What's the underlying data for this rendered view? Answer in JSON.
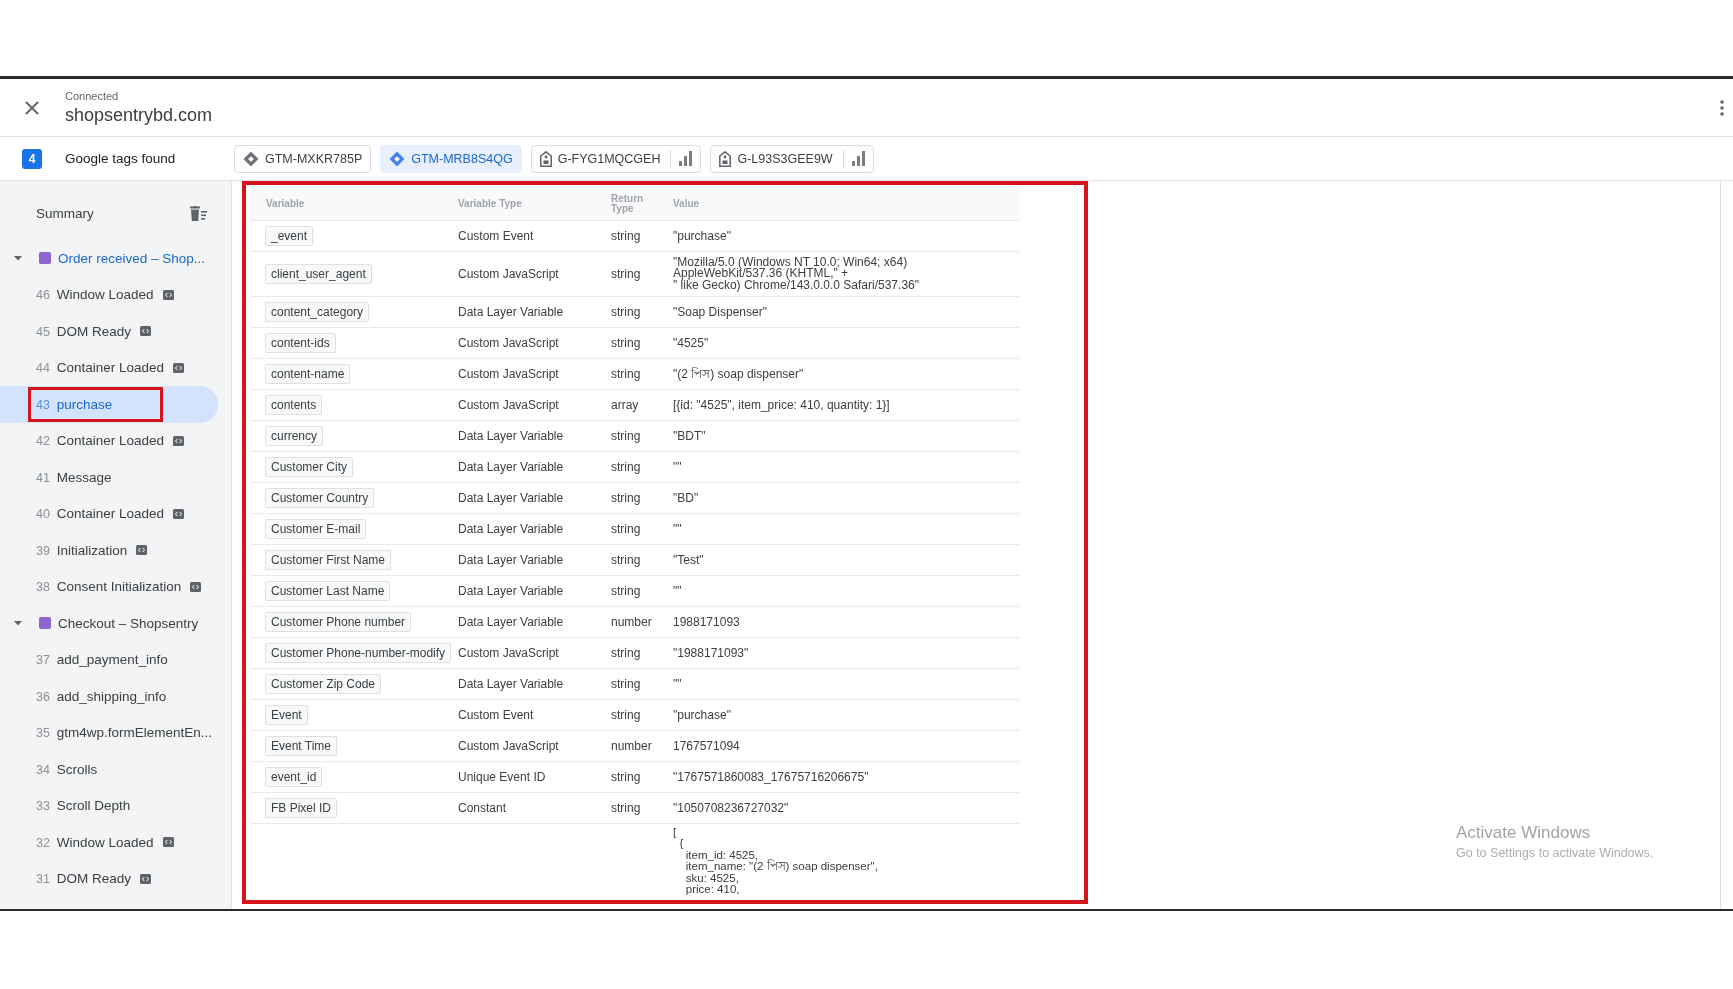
{
  "header": {
    "status": "Connected",
    "domain": "shopsentrybd.com"
  },
  "tags_bar": {
    "count": "4",
    "label": "Google tags found",
    "tags": [
      {
        "id": "GTM-MXKR785P",
        "kind": "gtm",
        "selected": false
      },
      {
        "id": "GTM-MRB8S4QG",
        "kind": "gtm",
        "selected": true
      },
      {
        "id": "G-FYG1MQCGEH",
        "kind": "ga",
        "selected": false
      },
      {
        "id": "G-L93S3GEE9W",
        "kind": "ga",
        "selected": false
      }
    ]
  },
  "sidebar": {
    "summary_label": "Summary",
    "groups": [
      {
        "title": "Order received – Shop...",
        "expanded": true,
        "selected": true,
        "items": [
          {
            "number": "46",
            "label": "Window Loaded",
            "builtin": true,
            "selected": false,
            "highlighted": false
          },
          {
            "number": "45",
            "label": "DOM Ready",
            "builtin": true,
            "selected": false,
            "highlighted": false
          },
          {
            "number": "44",
            "label": "Container Loaded",
            "builtin": true,
            "selected": false,
            "highlighted": false
          },
          {
            "number": "43",
            "label": "purchase",
            "builtin": false,
            "selected": true,
            "highlighted": true
          },
          {
            "number": "42",
            "label": "Container Loaded",
            "builtin": true,
            "selected": false,
            "highlighted": false
          },
          {
            "number": "41",
            "label": "Message",
            "builtin": false,
            "selected": false,
            "highlighted": false
          },
          {
            "number": "40",
            "label": "Container Loaded",
            "builtin": true,
            "selected": false,
            "highlighted": false
          },
          {
            "number": "39",
            "label": "Initialization",
            "builtin": true,
            "selected": false,
            "highlighted": false
          },
          {
            "number": "38",
            "label": "Consent Initialization",
            "builtin": true,
            "selected": false,
            "highlighted": false
          }
        ]
      },
      {
        "title": "Checkout – Shopsentry",
        "expanded": true,
        "selected": false,
        "items": [
          {
            "number": "37",
            "label": "add_payment_info",
            "builtin": false,
            "selected": false,
            "highlighted": false
          },
          {
            "number": "36",
            "label": "add_shipping_info",
            "builtin": false,
            "selected": false,
            "highlighted": false
          },
          {
            "number": "35",
            "label": "gtm4wp.formElementEn...",
            "builtin": false,
            "selected": false,
            "highlighted": false
          },
          {
            "number": "34",
            "label": "Scrolls",
            "builtin": false,
            "selected": false,
            "highlighted": false
          },
          {
            "number": "33",
            "label": "Scroll Depth",
            "builtin": false,
            "selected": false,
            "highlighted": false
          },
          {
            "number": "32",
            "label": "Window Loaded",
            "builtin": true,
            "selected": false,
            "highlighted": false
          },
          {
            "number": "31",
            "label": "DOM Ready",
            "builtin": true,
            "selected": false,
            "highlighted": false
          }
        ]
      }
    ]
  },
  "table": {
    "highlighted": true,
    "columns": [
      "Variable",
      "Variable Type",
      "Return Type",
      "Value"
    ],
    "rows": [
      {
        "variable": "_event",
        "type": "Custom Event",
        "return_type": "string",
        "value": "\"purchase\""
      },
      {
        "variable": "client_user_agent",
        "type": "Custom JavaScript",
        "return_type": "string",
        "value": "\"Mozilla/5.0 (Windows NT 10.0; Win64; x64)\nAppleWebKit/537.36 (KHTML,\" +\n\" like Gecko) Chrome/143.0.0.0 Safari/537.36\""
      },
      {
        "variable": "content_category",
        "type": "Data Layer Variable",
        "return_type": "string",
        "value": "\"Soap Dispenser\""
      },
      {
        "variable": "content-ids",
        "type": "Custom JavaScript",
        "return_type": "string",
        "value": "\"4525\""
      },
      {
        "variable": "content-name",
        "type": "Custom JavaScript",
        "return_type": "string",
        "value": "\"(2 পিস) soap dispenser\""
      },
      {
        "variable": "contents",
        "type": "Custom JavaScript",
        "return_type": "array",
        "value": "[{id: \"4525\", item_price: 410, quantity: 1}]"
      },
      {
        "variable": "currency",
        "type": "Data Layer Variable",
        "return_type": "string",
        "value": "\"BDT\""
      },
      {
        "variable": "Customer City",
        "type": "Data Layer Variable",
        "return_type": "string",
        "value": "\"\""
      },
      {
        "variable": "Customer Country",
        "type": "Data Layer Variable",
        "return_type": "string",
        "value": "\"BD\""
      },
      {
        "variable": "Customer E-mail",
        "type": "Data Layer Variable",
        "return_type": "string",
        "value": "\"\""
      },
      {
        "variable": "Customer First Name",
        "type": "Data Layer Variable",
        "return_type": "string",
        "value": "\"Test\""
      },
      {
        "variable": "Customer Last Name",
        "type": "Data Layer Variable",
        "return_type": "string",
        "value": "\"\""
      },
      {
        "variable": "Customer Phone number",
        "type": "Data Layer Variable",
        "return_type": "number",
        "value": "1988171093"
      },
      {
        "variable": "Customer Phone-number-modify",
        "type": "Custom JavaScript",
        "return_type": "string",
        "value": "\"1988171093\""
      },
      {
        "variable": "Customer Zip Code",
        "type": "Data Layer Variable",
        "return_type": "string",
        "value": "\"\""
      },
      {
        "variable": "Event",
        "type": "Custom Event",
        "return_type": "string",
        "value": "\"purchase\""
      },
      {
        "variable": "Event Time",
        "type": "Custom JavaScript",
        "return_type": "number",
        "value": "1767571094"
      },
      {
        "variable": "event_id",
        "type": "Unique Event ID",
        "return_type": "string",
        "value": "\"1767571860083_17675716206675\""
      },
      {
        "variable": "FB Pixel ID",
        "type": "Constant",
        "return_type": "string",
        "value": "\"1050708236727032\""
      },
      {
        "value": "[\n  {\n    item_id: 4525,\n    item_name: \"(2 পিস) soap dispenser\",\n    sku: 4525,\n    price: 410,"
      }
    ]
  },
  "os_notice": {
    "title": "Activate Windows",
    "text": "Go to Settings to activate Windows."
  }
}
